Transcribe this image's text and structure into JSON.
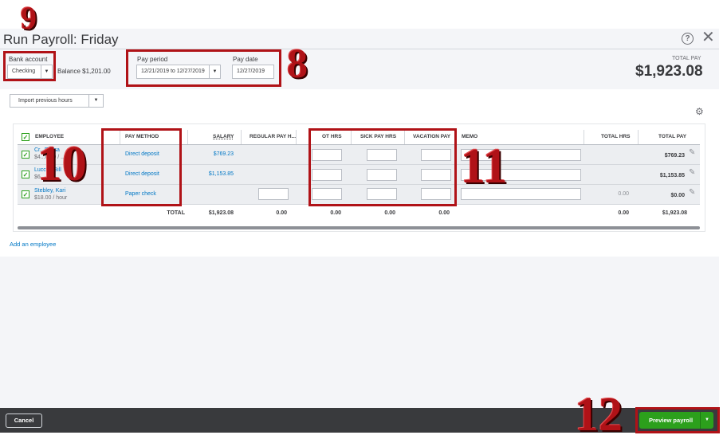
{
  "header": {
    "title": "Run Payroll: Friday",
    "help_symbol": "?",
    "close_symbol": "✕"
  },
  "bank": {
    "label": "Bank account",
    "value": "Checking",
    "balance": "Balance $1,201.00"
  },
  "pay_period": {
    "label": "Pay period",
    "value": "12/21/2019 to 12/27/2019"
  },
  "pay_date": {
    "label": "Pay date",
    "value": "12/27/2019"
  },
  "total_pay": {
    "label": "TOTAL PAY",
    "value": "$1,923.08"
  },
  "toolbar": {
    "import_label": "Import previous hours"
  },
  "table": {
    "headers": {
      "employee": "EMPLOYEE",
      "pay_method": "PAY METHOD",
      "salary": "SALARY",
      "regular": "REGULAR PAY H...",
      "ot": "OT HRS",
      "sick": "SICK PAY HRS",
      "vacation": "VACATION PAY",
      "memo": "MEMO",
      "total_hrs": "TOTAL HRS",
      "total_pay": "TOTAL PAY"
    },
    "rows": [
      {
        "name": "Cr...Eloisa",
        "rate": "$4...0.00 / ...",
        "pay_method": "Direct deposit",
        "salary": "$769.23",
        "total_hrs": "",
        "total_pay": "$769.23"
      },
      {
        "name": "Lucch...Bill",
        "rate": "$6...",
        "pay_method": "Direct deposit",
        "salary": "$1,153.85",
        "total_hrs": "",
        "total_pay": "$1,153.85"
      },
      {
        "name": "Stebley, Kari",
        "rate": "$18.00 / hour",
        "pay_method": "Paper check",
        "salary": "",
        "total_hrs": "0.00",
        "total_pay": "$0.00"
      }
    ],
    "totals": {
      "label": "TOTAL",
      "salary": "$1,923.08",
      "regular": "0.00",
      "ot": "0.00",
      "sick": "0.00",
      "vacation": "0.00",
      "total_hrs": "0.00",
      "total_pay": "$1,923.08"
    }
  },
  "add_employee": "Add an employee",
  "footer": {
    "cancel": "Cancel",
    "preview": "Preview payroll"
  },
  "annotations": {
    "n8": "8",
    "n9": "9",
    "n10": "10",
    "n11": "11",
    "n12": "12"
  },
  "colors": {
    "accent_green": "#2ca01c",
    "link_blue": "#0077c5",
    "annotation_red": "#b01217",
    "footer_dark": "#393a3d"
  }
}
